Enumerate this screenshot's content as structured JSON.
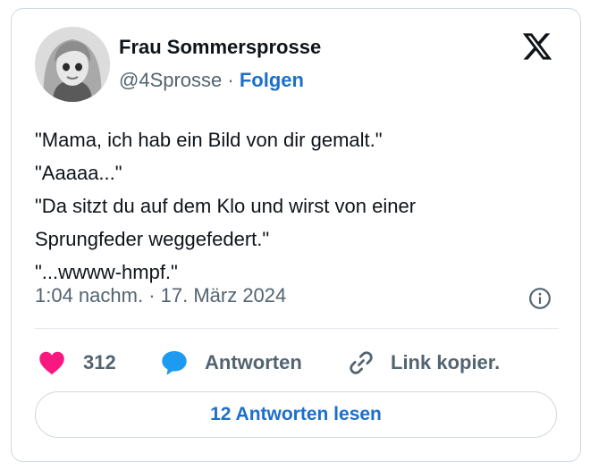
{
  "author": {
    "name": "Frau Sommersprosse",
    "handle": "@4Sprosse",
    "separator": "·",
    "follow_label": "Folgen"
  },
  "tweet": {
    "lines": [
      "\"Mama, ich hab ein Bild von dir gemalt.\"",
      "\"Aaaaa...\"",
      "\"Da sitzt du auf dem Klo und wirst von einer",
      "Sprungfeder weggefedert.\"",
      "\"...wwww-hmpf.\""
    ],
    "timestamp": "1:04 nachm. · 17. März 2024"
  },
  "actions": {
    "like_count": "312",
    "reply_label": "Antworten",
    "copy_link_label": "Link kopier."
  },
  "footer": {
    "read_replies_label": "12 Antworten lesen"
  },
  "colors": {
    "link_blue": "#1d6fc9",
    "heart_pink": "#f91880",
    "reply_bubble_blue": "#1d9bf0",
    "muted_gray": "#536471",
    "text": "#0f1419"
  },
  "icons": [
    "x-logo-icon",
    "heart-icon",
    "speech-bubble-icon",
    "link-icon",
    "info-icon"
  ]
}
